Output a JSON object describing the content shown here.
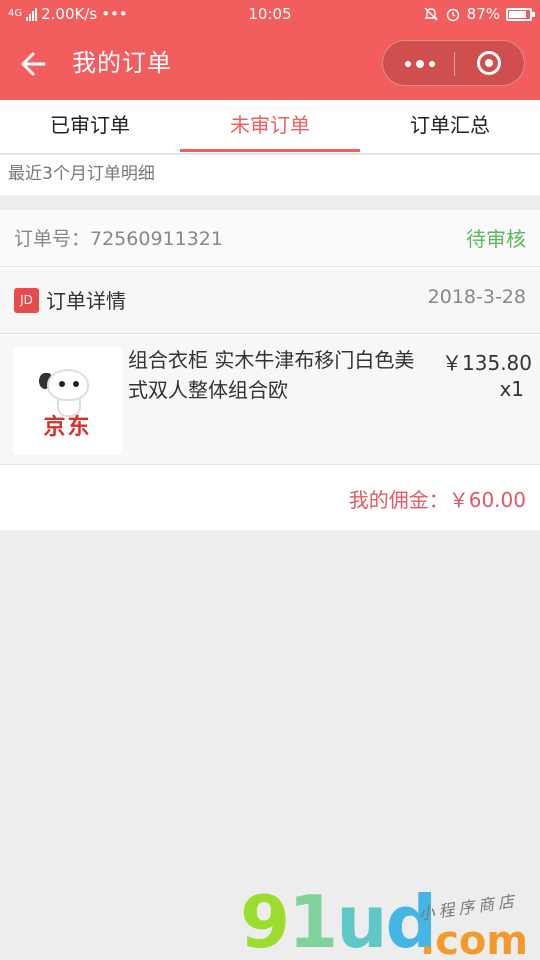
{
  "status_bar": {
    "network": "4G",
    "speed": "2.00K/s",
    "dots": "•••",
    "time": "10:05",
    "battery_text": "87%",
    "battery_level": 0.87
  },
  "header": {
    "title": "我的订单",
    "bg_color": "#f15e5d"
  },
  "tabs": [
    {
      "label": "已审订单",
      "active": false
    },
    {
      "label": "未审订单",
      "active": true
    },
    {
      "label": "订单汇总",
      "active": false
    }
  ],
  "subheading": "最近3个月订单明细",
  "order": {
    "order_no_label": "订单号：72560911321",
    "status": "待审核",
    "status_color": "#5cb85c",
    "detail_icon": "JD",
    "detail_label": "订单详情",
    "date": "2018-3-28",
    "product": {
      "logo_text": "京东",
      "name": "组合衣柜 实木牛津布移门白色美式双人整体组合欧",
      "price": "￥135.80",
      "qty": "x1"
    },
    "commission": "我的佣金：￥60.00"
  },
  "watermark": {
    "main": "91ud",
    "sub": ".com",
    "tag": "小程序商店"
  },
  "icons": [
    "back-arrow-icon",
    "more-dots-icon",
    "close-target-icon",
    "jd-icon",
    "jd-logo-dog"
  ]
}
